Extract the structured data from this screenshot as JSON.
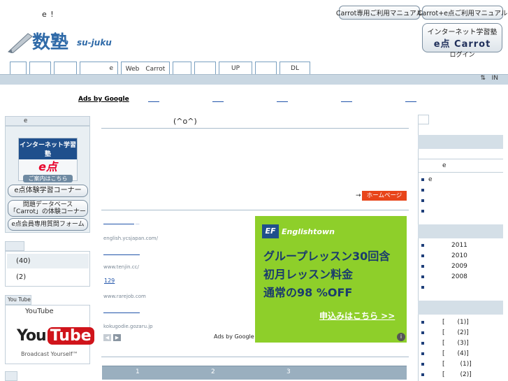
{
  "header": {
    "tagline": "e !",
    "buttons": [
      "Carrot専用ご利用マニュアル",
      "Carrot+e点ご利用マニュアル"
    ],
    "logo_text": "数塾",
    "logo_sub": "su-juku",
    "login": {
      "line1": "インターネット学習塾",
      "line2": "e点 Carrot",
      "line3": "ログイン"
    }
  },
  "nav": {
    "tabs": [
      "",
      "",
      "",
      "e",
      "Web　Carrot",
      "",
      "",
      "UP",
      "",
      "DL"
    ],
    "right": "IN"
  },
  "ads": {
    "label": "Ads by Google"
  },
  "left": {
    "head1": "e",
    "promo": {
      "line1": "インターネット学習塾",
      "line2": "e点",
      "line3": "ご案内はこちら"
    },
    "pill1": "e点体験学習コーナー",
    "pill2a": "問題データベース",
    "pill2b": "「Carrot」の体験コーナー",
    "pill3": "e点会員専用質問フォーム",
    "counts": [
      "(40)",
      "(2)"
    ],
    "youtube_head": "You Tube",
    "youtube_label": "YouTube",
    "youtube_logo1": "You",
    "youtube_logo2": "Tube",
    "youtube_tag": "Broadcast Yourself™"
  },
  "center": {
    "smile": "(^o^)",
    "homepage_button": "ホームページ",
    "homepage_arrow": "→",
    "text_ads": [
      {
        "url": "english.ycsjapan.com/"
      },
      {
        "url": "www.tenjin.cc/"
      },
      {
        "title": "129"
      },
      {
        "url": "www.rarejob.com"
      },
      {
        "url": "kokugodie.gozaru.jp"
      }
    ],
    "ads_by_google": "Ads by Google",
    "banner": {
      "brand_icon": "EF",
      "brand": "Englishtown",
      "line1": "グループレッスン30回含",
      "line2": "初月レッスン料金",
      "line3": "通常の98 %OFF",
      "cta": "申込みはこちら >>"
    },
    "pager": [
      "1",
      "2",
      "3"
    ]
  },
  "right": {
    "e_label": "e",
    "list1": [
      "e",
      "",
      "",
      ""
    ],
    "years": [
      "2011",
      "2010",
      "2009",
      "2008",
      ""
    ],
    "archive": [
      {
        "b": "[",
        "v": "(1)]"
      },
      {
        "b": "[",
        "v": "(2)]"
      },
      {
        "b": "[",
        "v": "(3)]"
      },
      {
        "b": "[",
        "v": "(4)]"
      },
      {
        "b": "[",
        "v": "(1)]"
      },
      {
        "b": "[",
        "v": "(2)]"
      }
    ]
  }
}
